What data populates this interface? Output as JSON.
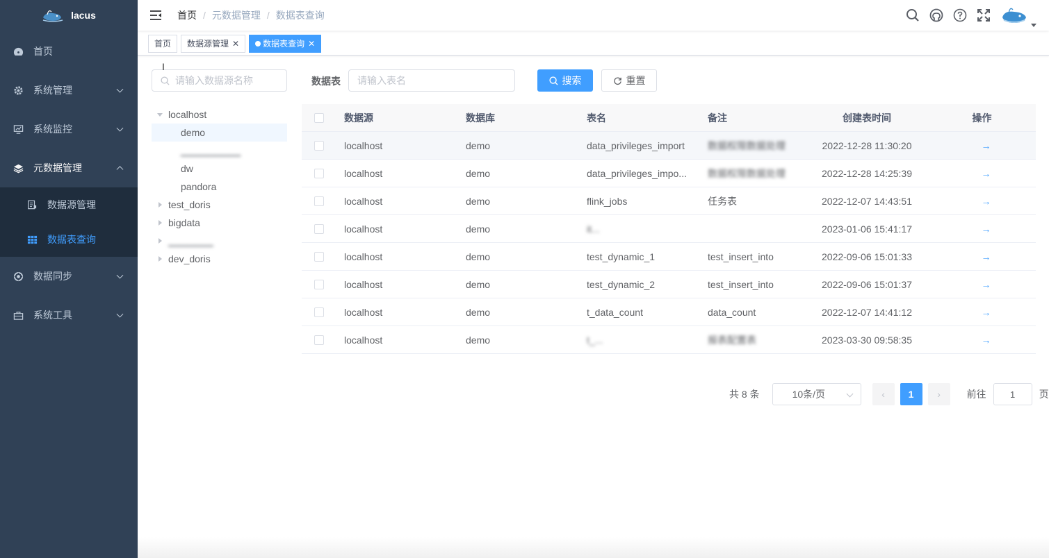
{
  "app": {
    "name": "lacus"
  },
  "sidebar": {
    "items": [
      {
        "label": "首页",
        "icon": "dashboard-icon"
      },
      {
        "label": "系统管理",
        "icon": "gear-icon"
      },
      {
        "label": "系统监控",
        "icon": "monitor-icon"
      },
      {
        "label": "元数据管理",
        "icon": "layers-icon",
        "expanded": true,
        "children": [
          {
            "label": "数据源管理",
            "icon": "document-icon"
          },
          {
            "label": "数据表查询",
            "icon": "table-icon",
            "active": true
          }
        ]
      },
      {
        "label": "数据同步",
        "icon": "sync-icon"
      },
      {
        "label": "系统工具",
        "icon": "toolbox-icon"
      }
    ]
  },
  "breadcrumb": [
    "首页",
    "元数据管理",
    "数据表查询"
  ],
  "tags": [
    {
      "label": "首页"
    },
    {
      "label": "数据源管理",
      "closable": true
    },
    {
      "label": "数据表查询",
      "closable": true,
      "active": true
    }
  ],
  "tree": {
    "search_placeholder": "请输入数据源名称",
    "nodes": [
      {
        "label": "localhost",
        "expanded": true,
        "children": [
          "demo",
          "",
          "dw",
          "pandora"
        ]
      },
      {
        "label": "test_doris"
      },
      {
        "label": "bigdata"
      },
      {
        "label": ""
      },
      {
        "label": "dev_doris"
      }
    ]
  },
  "search": {
    "label": "数据表",
    "placeholder": "请输入表名",
    "search_button": "搜索",
    "reset_button": "重置"
  },
  "table": {
    "headers": [
      "数据源",
      "数据库",
      "表名",
      "备注",
      "创建表时间",
      "操作"
    ],
    "rows": [
      {
        "source": "localhost",
        "db": "demo",
        "name": "data_privileges_import",
        "note": "数据权限数据处理",
        "time": "2022-12-28 11:30:20",
        "note_blurred": true
      },
      {
        "source": "localhost",
        "db": "demo",
        "name": "data_privileges_impo...",
        "note": "数据权限数据处理",
        "time": "2022-12-28 14:25:39",
        "note_blurred": true
      },
      {
        "source": "localhost",
        "db": "demo",
        "name": "flink_jobs",
        "note": "任务表",
        "time": "2022-12-07 14:43:51"
      },
      {
        "source": "localhost",
        "db": "demo",
        "name": "it...",
        "note": "",
        "time": "2023-01-06 15:41:17",
        "name_blurred": true
      },
      {
        "source": "localhost",
        "db": "demo",
        "name": "test_dynamic_1",
        "note": "test_insert_into",
        "time": "2022-09-06 15:01:33"
      },
      {
        "source": "localhost",
        "db": "demo",
        "name": "test_dynamic_2",
        "note": "test_insert_into",
        "time": "2022-09-06 15:01:37"
      },
      {
        "source": "localhost",
        "db": "demo",
        "name": "t_data_count",
        "note": "data_count",
        "time": "2022-12-07 14:41:12"
      },
      {
        "source": "localhost",
        "db": "demo",
        "name": "t_...",
        "note": "报表配置表",
        "time": "2023-03-30 09:58:35",
        "name_blurred": true,
        "note_blurred": true
      }
    ],
    "op_symbol": "→"
  },
  "pagination": {
    "total": "共 8 条",
    "page_size": "10条/页",
    "current": "1",
    "goto_label": "前往",
    "goto_value": "1",
    "page_unit": "页"
  },
  "colors": {
    "sidebar_bg": "#304156",
    "submenu_bg": "#1f2d3d",
    "primary": "#409eff"
  }
}
